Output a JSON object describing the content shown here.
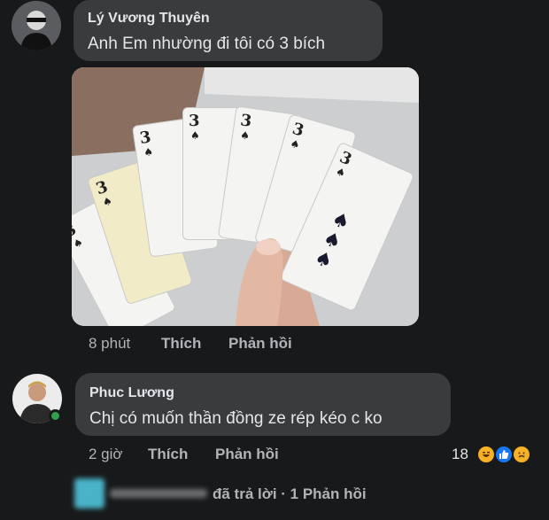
{
  "comments": [
    {
      "author": "Lý Vương Thuyên",
      "text": "Anh Em nhường đi tôi có 3 bích",
      "time": "8 phút",
      "like_label": "Thích",
      "reply_label": "Phản hồi",
      "photo": {
        "card_rank": "3",
        "card_suit": "♠"
      }
    },
    {
      "author": "Phuc Lương",
      "text": "Chị có muốn thần đồng ze rép kéo c ko",
      "time": "2 giờ",
      "like_label": "Thích",
      "reply_label": "Phản hồi",
      "online": true,
      "reactions": {
        "count": "18",
        "icons": [
          "haha-icon",
          "like-icon",
          "sad-icon"
        ]
      }
    }
  ],
  "reply_summary": {
    "text": "đã trả lời · 1 Phản hồi"
  },
  "colors": {
    "background": "#18191a",
    "bubble": "#3a3b3c",
    "text_primary": "#e4e6eb",
    "text_secondary": "#b0b3b8",
    "online": "#31a24c"
  }
}
